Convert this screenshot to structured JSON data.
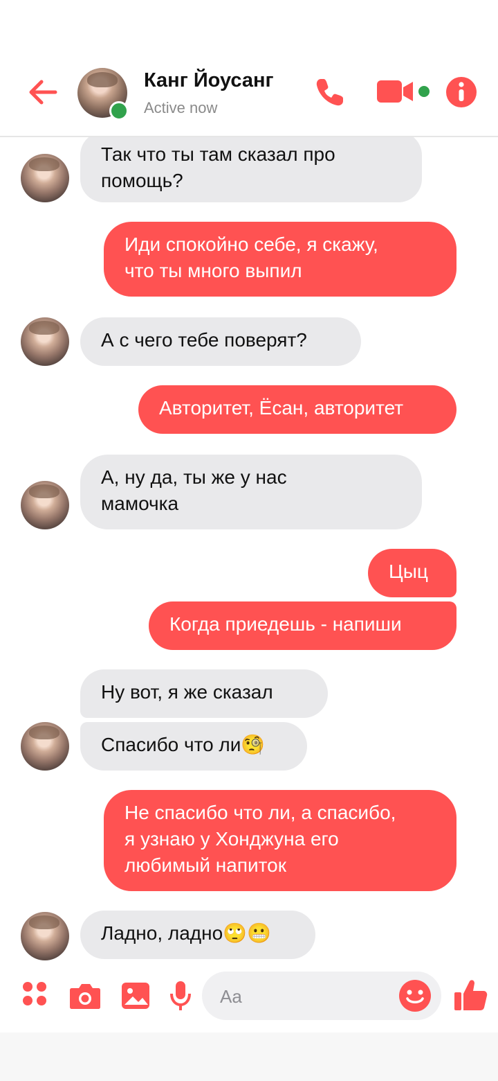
{
  "header": {
    "contact_name": "Канг Йоусанг",
    "status": "Active now"
  },
  "colors": {
    "accent": "#ff5252",
    "online": "#31a24c",
    "incoming_bubble": "#e9e9eb"
  },
  "icons": [
    "back-arrow-icon",
    "phone-icon",
    "video-camera-icon",
    "info-icon",
    "apps-icon",
    "camera-icon",
    "image-icon",
    "microphone-icon",
    "emoji-icon",
    "thumbs-up-icon"
  ],
  "messages": [
    {
      "dir": "in",
      "text": "Так что ты там сказал про\nпомощь?"
    },
    {
      "dir": "out",
      "text": "Иди спокойно себе, я скажу,\nчто ты много выпил"
    },
    {
      "dir": "in",
      "text": "А с чего тебе поверят?"
    },
    {
      "dir": "out",
      "text": "Авторитет, Ёсан, авторитет"
    },
    {
      "dir": "in",
      "text": "А, ну да, ты же у нас\nмамочка"
    },
    {
      "dir": "out",
      "text": "Цыц"
    },
    {
      "dir": "out",
      "text": "Когда приедешь - напиши"
    },
    {
      "dir": "in",
      "text": "Ну вот, я же сказал"
    },
    {
      "dir": "in",
      "text": "Спасибо что ли🧐"
    },
    {
      "dir": "out",
      "text": "Не спасибо что ли, а спасибо,\nя узнаю у Хонджуна его\nлюбимый напиток"
    },
    {
      "dir": "in",
      "text": "Ладно, ладно🙄😬"
    }
  ],
  "composer": {
    "placeholder": "Aa"
  }
}
